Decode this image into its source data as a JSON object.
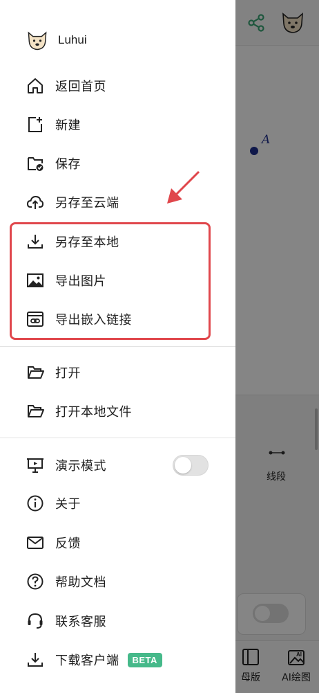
{
  "background": {
    "point_label": "A",
    "tool_segment_label": "线段",
    "bottom_items": [
      {
        "label": "母版",
        "icon": "template-icon"
      },
      {
        "label": "AI绘图",
        "icon": "ai-image-icon"
      }
    ],
    "share_icon": "share-icon",
    "accent_green": "#3aa676"
  },
  "drawer": {
    "username": "Luhui",
    "items": [
      {
        "label": "返回首页",
        "icon": "home-icon"
      },
      {
        "label": "新建",
        "icon": "new-file-icon"
      },
      {
        "label": "保存",
        "icon": "save-folder-icon"
      },
      {
        "label": "另存至云端",
        "icon": "cloud-upload-icon"
      },
      {
        "label": "另存至本地",
        "icon": "download-icon"
      },
      {
        "label": "导出图片",
        "icon": "image-icon"
      },
      {
        "label": "导出嵌入链接",
        "icon": "embed-link-icon"
      },
      {
        "label": "打开",
        "icon": "folder-open-icon"
      },
      {
        "label": "打开本地文件",
        "icon": "folder-open-icon"
      },
      {
        "label": "演示模式",
        "icon": "presentation-icon",
        "toggle_on": false
      },
      {
        "label": "关于",
        "icon": "info-icon"
      },
      {
        "label": "反馈",
        "icon": "mail-icon"
      },
      {
        "label": "帮助文档",
        "icon": "help-icon"
      },
      {
        "label": "联系客服",
        "icon": "headset-icon"
      },
      {
        "label": "下载客户端",
        "icon": "download-icon",
        "badge": "BETA"
      }
    ],
    "badge_color": "#46b98a",
    "highlight_color": "#e0474c"
  }
}
